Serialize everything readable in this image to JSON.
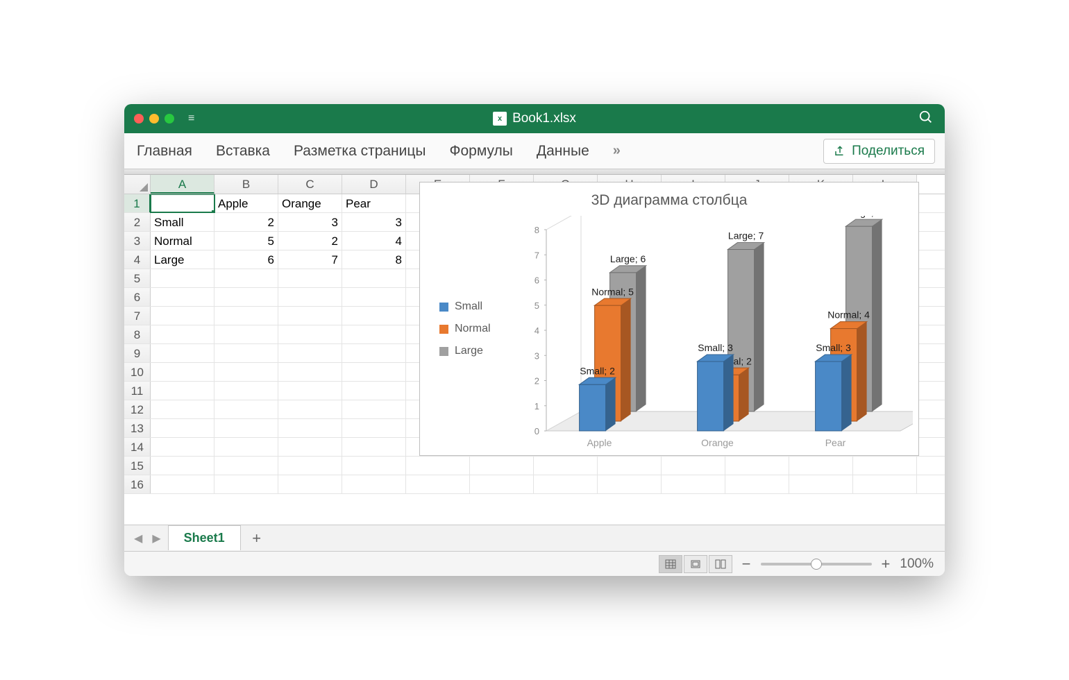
{
  "window": {
    "title": "Book1.xlsx"
  },
  "ribbon": {
    "tabs": [
      "Главная",
      "Вставка",
      "Разметка страницы",
      "Формулы",
      "Данные"
    ],
    "more": "»",
    "share": "Поделиться"
  },
  "columns": [
    "A",
    "B",
    "C",
    "D",
    "E",
    "F",
    "G",
    "H",
    "I",
    "J",
    "K",
    "L"
  ],
  "rows": [
    "1",
    "2",
    "3",
    "4",
    "5",
    "6",
    "7",
    "8",
    "9",
    "10",
    "11",
    "12",
    "13",
    "14",
    "15",
    "16"
  ],
  "cells": {
    "B1": "Apple",
    "C1": "Orange",
    "D1": "Pear",
    "A2": "Small",
    "B2": "2",
    "C2": "3",
    "D2": "3",
    "A3": "Normal",
    "B3": "5",
    "C3": "2",
    "D3": "4",
    "A4": "Large",
    "B4": "6",
    "C4": "7",
    "D4": "8"
  },
  "sheet": {
    "active": "Sheet1"
  },
  "status": {
    "zoom": "100%"
  },
  "chart_data": {
    "type": "bar",
    "title": "3D диаграмма столбца",
    "categories": [
      "Apple",
      "Orange",
      "Pear"
    ],
    "series": [
      {
        "name": "Small",
        "values": [
          2,
          3,
          3
        ],
        "color": "#4a89c7"
      },
      {
        "name": "Normal",
        "values": [
          5,
          2,
          4
        ],
        "color": "#e8792f"
      },
      {
        "name": "Large",
        "values": [
          6,
          7,
          8
        ],
        "color": "#a0a0a0"
      }
    ],
    "ylim": [
      0,
      8
    ],
    "yticks": [
      0,
      1,
      2,
      3,
      4,
      5,
      6,
      7,
      8
    ],
    "data_labels": true,
    "xlabel": "",
    "ylabel": ""
  }
}
